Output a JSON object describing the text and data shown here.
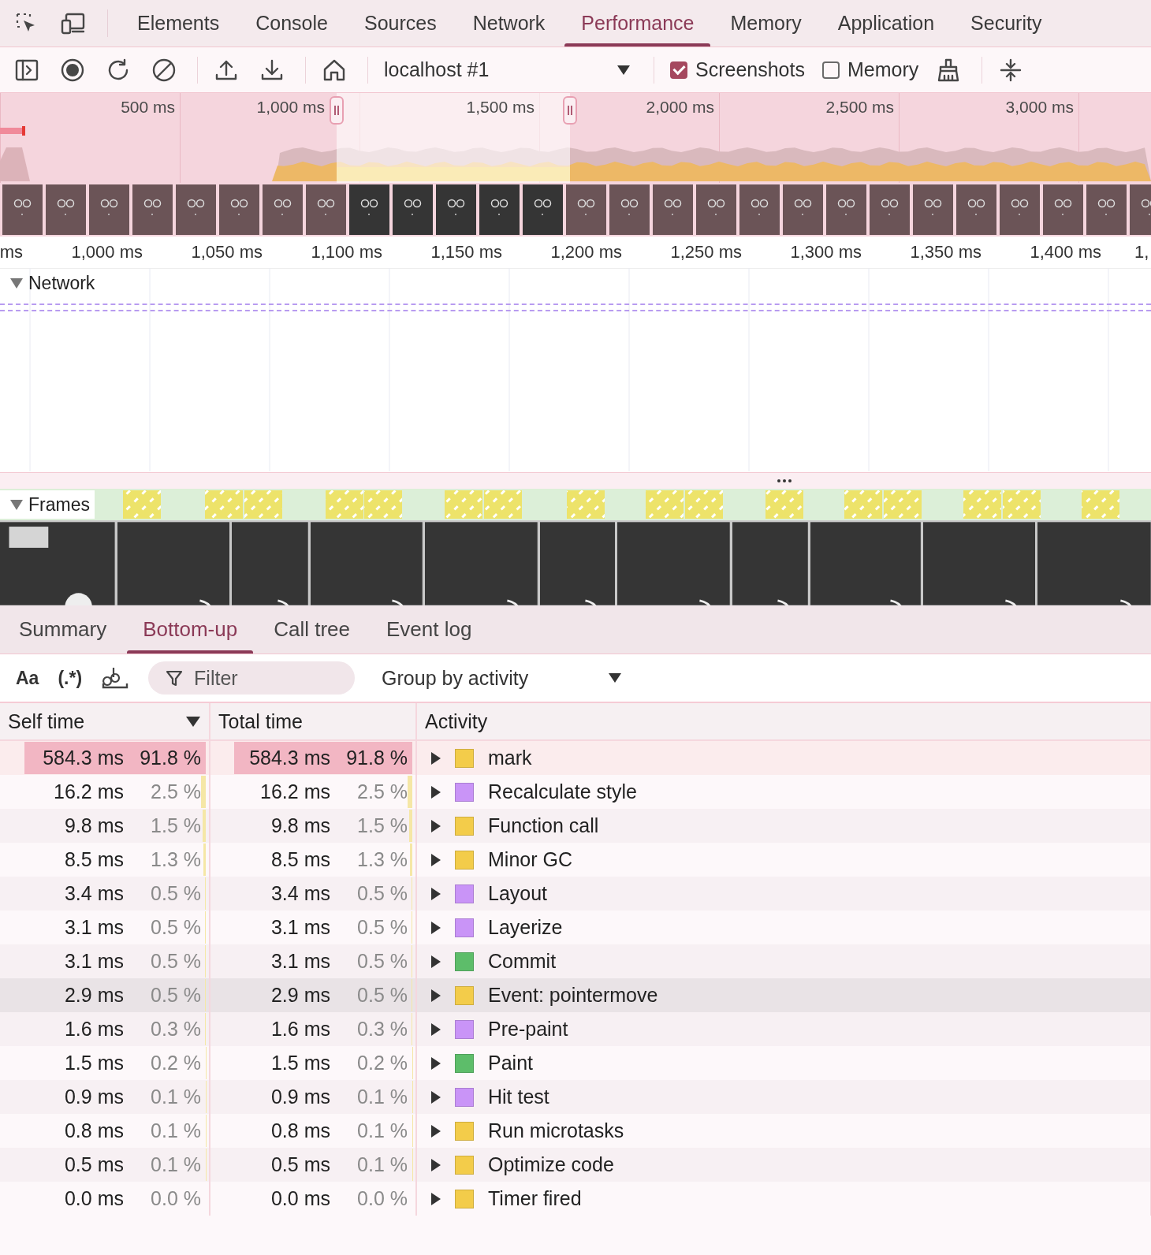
{
  "main_tabs": [
    {
      "label": "Elements",
      "selected": false
    },
    {
      "label": "Console",
      "selected": false
    },
    {
      "label": "Sources",
      "selected": false
    },
    {
      "label": "Network",
      "selected": false
    },
    {
      "label": "Performance",
      "selected": true
    },
    {
      "label": "Memory",
      "selected": false
    },
    {
      "label": "Application",
      "selected": false
    },
    {
      "label": "Security",
      "selected": false
    }
  ],
  "toolbar": {
    "target": "localhost #1",
    "screenshots": {
      "label": "Screenshots",
      "checked": true
    },
    "memory": {
      "label": "Memory",
      "checked": false
    }
  },
  "overview": {
    "ticks": [
      "500 ms",
      "1,000 ms",
      "1,500 ms",
      "2,000 ms",
      "2,500 ms",
      "3,000 ms"
    ]
  },
  "timeline": {
    "ticks": [
      "ms",
      "1,000 ms",
      "1,050 ms",
      "1,100 ms",
      "1,150 ms",
      "1,200 ms",
      "1,250 ms",
      "1,300 ms",
      "1,350 ms",
      "1,400 ms",
      "1,"
    ],
    "tracks": [
      {
        "label": "Network",
        "expanded": true
      },
      {
        "label": "Frames",
        "expanded": true
      }
    ]
  },
  "detail_tabs": [
    {
      "label": "Summary",
      "selected": false
    },
    {
      "label": "Bottom-up",
      "selected": true
    },
    {
      "label": "Call tree",
      "selected": false
    },
    {
      "label": "Event log",
      "selected": false
    }
  ],
  "filter": {
    "match_case": "Aa",
    "regex": "(.*)",
    "placeholder": "Filter",
    "group_by": "Group by activity"
  },
  "table": {
    "columns": [
      "Self time",
      "Total time",
      "Activity"
    ],
    "rows": [
      {
        "self_time": "584.3 ms",
        "self_percent": "91.8 %",
        "total_time": "584.3 ms",
        "total_percent": "91.8 %",
        "level": 0.918,
        "activity": "mark",
        "color": "#f3cc4a",
        "selected": true,
        "hovered": false
      },
      {
        "self_time": "16.2 ms",
        "self_percent": "2.5 %",
        "total_time": "16.2 ms",
        "total_percent": "2.5 %",
        "level": 0.025,
        "activity": "Recalculate style",
        "color": "#c994f7",
        "selected": false,
        "hovered": false
      },
      {
        "self_time": "9.8 ms",
        "self_percent": "1.5 %",
        "total_time": "9.8 ms",
        "total_percent": "1.5 %",
        "level": 0.015,
        "activity": "Function call",
        "color": "#f3cc4a",
        "selected": false,
        "hovered": false
      },
      {
        "self_time": "8.5 ms",
        "self_percent": "1.3 %",
        "total_time": "8.5 ms",
        "total_percent": "1.3 %",
        "level": 0.013,
        "activity": "Minor GC",
        "color": "#f3cc4a",
        "selected": false,
        "hovered": false
      },
      {
        "self_time": "3.4 ms",
        "self_percent": "0.5 %",
        "total_time": "3.4 ms",
        "total_percent": "0.5 %",
        "level": 0.005,
        "activity": "Layout",
        "color": "#c994f7",
        "selected": false,
        "hovered": false
      },
      {
        "self_time": "3.1 ms",
        "self_percent": "0.5 %",
        "total_time": "3.1 ms",
        "total_percent": "0.5 %",
        "level": 0.005,
        "activity": "Layerize",
        "color": "#c994f7",
        "selected": false,
        "hovered": false
      },
      {
        "self_time": "3.1 ms",
        "self_percent": "0.5 %",
        "total_time": "3.1 ms",
        "total_percent": "0.5 %",
        "level": 0.005,
        "activity": "Commit",
        "color": "#5dbd6a",
        "selected": false,
        "hovered": false
      },
      {
        "self_time": "2.9 ms",
        "self_percent": "0.5 %",
        "total_time": "2.9 ms",
        "total_percent": "0.5 %",
        "level": 0.005,
        "activity": "Event: pointermove",
        "color": "#f3cc4a",
        "selected": false,
        "hovered": true
      },
      {
        "self_time": "1.6 ms",
        "self_percent": "0.3 %",
        "total_time": "1.6 ms",
        "total_percent": "0.3 %",
        "level": 0.003,
        "activity": "Pre-paint",
        "color": "#c994f7",
        "selected": false,
        "hovered": false
      },
      {
        "self_time": "1.5 ms",
        "self_percent": "0.2 %",
        "total_time": "1.5 ms",
        "total_percent": "0.2 %",
        "level": 0.002,
        "activity": "Paint",
        "color": "#5dbd6a",
        "selected": false,
        "hovered": false
      },
      {
        "self_time": "0.9 ms",
        "self_percent": "0.1 %",
        "total_time": "0.9 ms",
        "total_percent": "0.1 %",
        "level": 0.001,
        "activity": "Hit test",
        "color": "#c994f7",
        "selected": false,
        "hovered": false
      },
      {
        "self_time": "0.8 ms",
        "self_percent": "0.1 %",
        "total_time": "0.8 ms",
        "total_percent": "0.1 %",
        "level": 0.001,
        "activity": "Run microtasks",
        "color": "#f3cc4a",
        "selected": false,
        "hovered": false
      },
      {
        "self_time": "0.5 ms",
        "self_percent": "0.1 %",
        "total_time": "0.5 ms",
        "total_percent": "0.1 %",
        "level": 0.001,
        "activity": "Optimize code",
        "color": "#f3cc4a",
        "selected": false,
        "hovered": false
      },
      {
        "self_time": "0.0 ms",
        "self_percent": "0.0 %",
        "total_time": "0.0 ms",
        "total_percent": "0.0 %",
        "level": 0,
        "activity": "Timer fired",
        "color": "#f3cc4a",
        "selected": false,
        "hovered": false
      }
    ]
  }
}
